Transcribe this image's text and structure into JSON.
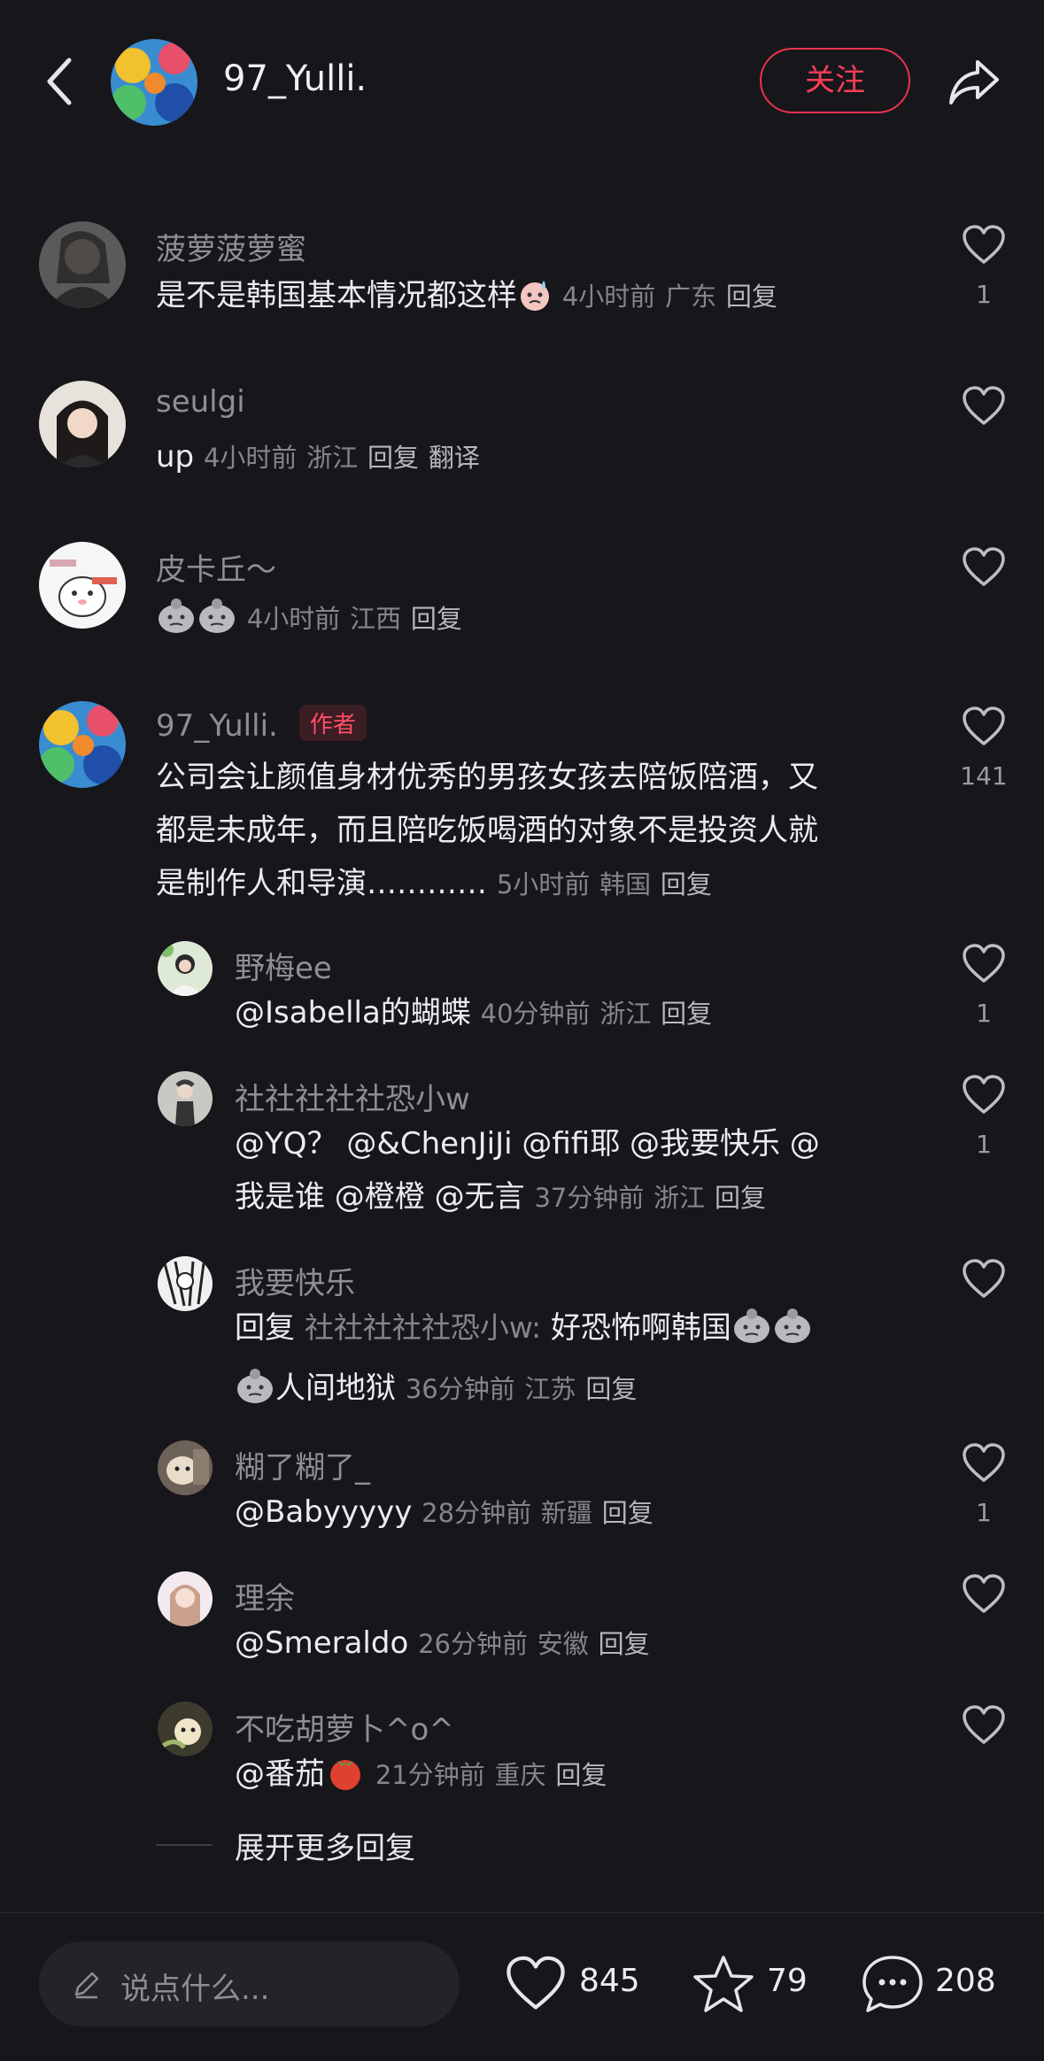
{
  "header": {
    "username": "97_Yulli.",
    "follow_label": "关注",
    "back_icon": "chevron-left-icon",
    "share_icon": "share-arrow-icon"
  },
  "comments": [
    {
      "name": "菠萝菠萝蜜",
      "text": "是不是韩国基本情况都这样",
      "time": "4小时前",
      "location": "广东",
      "reply": "回复",
      "likes": "1"
    },
    {
      "name": "seulgi",
      "text": "up",
      "time": "4小时前",
      "location": "浙江",
      "reply": "回复",
      "translate": "翻译"
    },
    {
      "name": "皮卡丘～",
      "time": "4小时前",
      "location": "江西",
      "reply": "回复"
    },
    {
      "name": "97_Yulli.",
      "author_tag": "作者",
      "text_line1": "公司会让颜值身材优秀的男孩女孩去陪饭陪酒，又",
      "text_line2": "都是未成年，而且陪吃饭喝酒的对象不是投资人就",
      "text_line3": "是制作人和导演…………",
      "time": "5小时前",
      "location": "韩国",
      "reply": "回复",
      "likes": "141"
    }
  ],
  "replies": [
    {
      "name": "野梅ee",
      "text": "@Isabella的蝴蝶",
      "time": "40分钟前",
      "location": "浙江",
      "reply": "回复",
      "likes": "1"
    },
    {
      "name": "社社社社社恐小w",
      "text_line1": "@YQ？ @&ChenJiJi @fifi耶 @我要快乐 @",
      "text_line2": "我是谁 @橙橙 @无言",
      "time": "37分钟前",
      "location": "浙江",
      "reply": "回复",
      "likes": "1"
    },
    {
      "name": "我要快乐",
      "reply_prefix": "回复",
      "reply_to": "社社社社社恐小w:",
      "text_line1": "好恐怖啊韩国",
      "text_line2": "人间地狱",
      "time": "36分钟前",
      "location": "江苏",
      "reply": "回复"
    },
    {
      "name": "糊了糊了_",
      "text": "@Babyyyyy",
      "time": "28分钟前",
      "location": "新疆",
      "reply": "回复",
      "likes": "1"
    },
    {
      "name": "理余",
      "text": "@Smeraldo",
      "time": "26分钟前",
      "location": "安徽",
      "reply": "回复"
    },
    {
      "name": "不吃胡萝卜^o^",
      "text": "@番茄",
      "time": "21分钟前",
      "location": "重庆",
      "reply": "回复"
    }
  ],
  "expand_label": "展开更多回复",
  "bottom": {
    "input_placeholder": "说点什么...",
    "likes": "845",
    "favorites": "79",
    "comments": "208"
  },
  "colors": {
    "background": "#17161b",
    "accent": "#ff3d59",
    "muted": "#85858c"
  }
}
